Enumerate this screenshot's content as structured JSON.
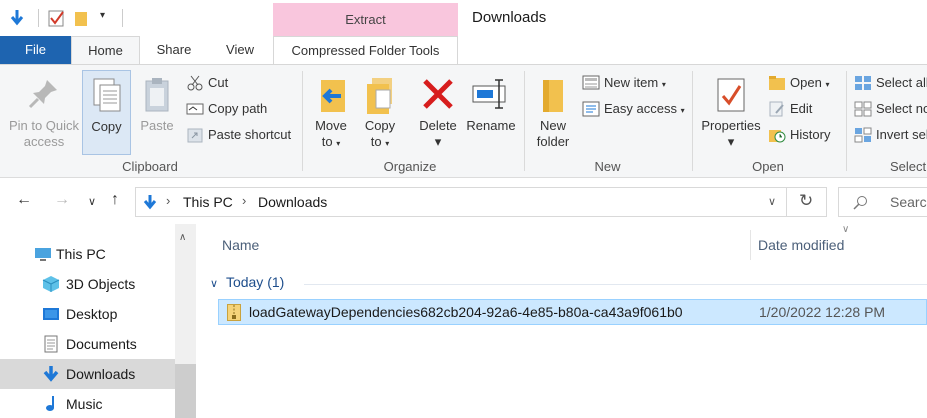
{
  "window": {
    "title": "Downloads",
    "contextual_tab_group": "Extract"
  },
  "tabs": {
    "file": "File",
    "home": "Home",
    "share": "Share",
    "view": "View",
    "compressed": "Compressed Folder Tools"
  },
  "ribbon": {
    "clipboard": {
      "label": "Clipboard",
      "pin_line1": "Pin to Quick",
      "pin_line2": "access",
      "copy": "Copy",
      "paste": "Paste",
      "cut": "Cut",
      "copy_path": "Copy path",
      "paste_shortcut": "Paste shortcut"
    },
    "organize": {
      "label": "Organize",
      "move_line1": "Move",
      "move_line2": "to",
      "copy_line1": "Copy",
      "copy_line2": "to",
      "delete": "Delete",
      "rename": "Rename"
    },
    "new": {
      "label": "New",
      "folder_line1": "New",
      "folder_line2": "folder",
      "new_item": "New item",
      "easy_access": "Easy access"
    },
    "open": {
      "label": "Open",
      "properties": "Properties",
      "open": "Open",
      "edit": "Edit",
      "history": "History"
    },
    "select": {
      "label": "Select",
      "select_all": "Select all",
      "select_none": "Select no",
      "invert": "Invert sel"
    }
  },
  "address": {
    "crumbs": [
      "This PC",
      "Downloads"
    ],
    "search_placeholder": "Searc"
  },
  "nav_pane": {
    "items": [
      "This PC",
      "3D Objects",
      "Desktop",
      "Documents",
      "Downloads",
      "Music"
    ],
    "selected": "Downloads"
  },
  "content": {
    "columns": {
      "name": "Name",
      "date": "Date modified"
    },
    "group": "Today (1)",
    "files": [
      {
        "name": "loadGatewayDependencies682cb204-92a6-4e85-b80a-ca43a9f061b0",
        "date": "1/20/2022 12:28 PM"
      }
    ]
  },
  "colors": {
    "file_tab": "#1e64b0",
    "contextual": "#f9c6dd",
    "selection": "#cce8ff",
    "accent_blue": "#1e78d7"
  }
}
